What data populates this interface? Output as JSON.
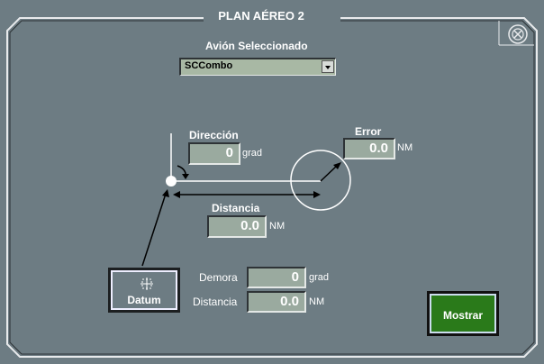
{
  "window": {
    "title": "PLAN AÉREO 2"
  },
  "aircraft": {
    "label": "Avión Seleccionado",
    "selected": "SCCombo"
  },
  "direccion": {
    "label": "Dirección",
    "value": "0",
    "unit": "grad"
  },
  "error": {
    "label": "Error",
    "value": "0.0",
    "unit": "NM"
  },
  "distancia": {
    "label": "Distancia",
    "value": "0.0",
    "unit": "NM"
  },
  "demora": {
    "label": "Demora",
    "value": "0",
    "unit": "grad"
  },
  "distancia2": {
    "label": "Distancia",
    "value": "0.0",
    "unit": "NM"
  },
  "buttons": {
    "datum": "Datum",
    "mostrar": "Mostrar"
  },
  "icons": {
    "close": "close-icon",
    "datum": "crosshair-icon",
    "dropdown": "chevron-down-icon"
  },
  "colors": {
    "panel": "#6d7c83",
    "field": "#9aaa9f",
    "mostrar": "#2a7a1a"
  }
}
